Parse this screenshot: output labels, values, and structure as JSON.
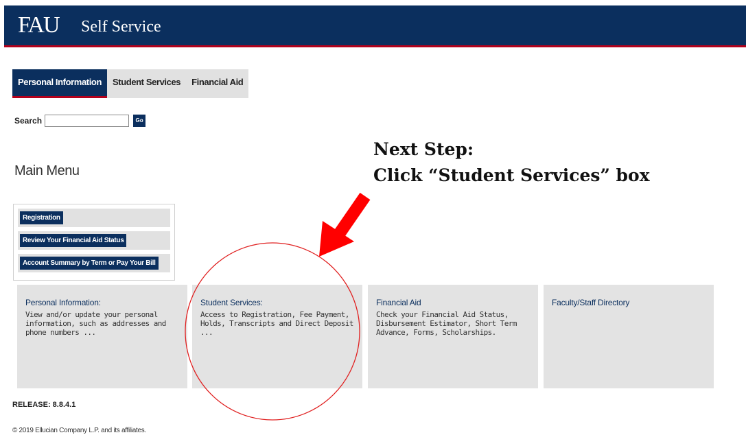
{
  "header": {
    "logo_text": "FAU",
    "app_title": "Self Service",
    "background": "#0b2f5e",
    "accent": "#b3001b"
  },
  "tabs": [
    {
      "label": "Personal Information",
      "active": true
    },
    {
      "label": "Student Services",
      "active": false
    },
    {
      "label": "Financial Aid",
      "active": false
    }
  ],
  "search": {
    "label": "Search",
    "value": "",
    "placeholder": "",
    "button_label": "Go"
  },
  "main_menu": {
    "title": "Main Menu",
    "quick_links": [
      {
        "label": "Registration"
      },
      {
        "label": "Review Your Financial Aid Status"
      },
      {
        "label": "Account Summary by Term or Pay Your Bill"
      }
    ],
    "cards": [
      {
        "title": "Personal Information:",
        "description": "View and/or update your personal information, such as addresses and phone numbers ..."
      },
      {
        "title": "Student Services:",
        "description": "Access to Registration, Fee Payment, Holds, Transcripts and Direct Deposit ..."
      },
      {
        "title": "Financial Aid",
        "description": "Check your Financial Aid Status, Disbursement Estimator, Short Term Advance, Forms, Scholarships."
      },
      {
        "title": "Faculty/Staff Directory",
        "description": ""
      }
    ]
  },
  "footer": {
    "release": "RELEASE: 8.8.4.1",
    "copyright": "© 2019 Ellucian Company L.P. and its affiliates."
  },
  "annotation": {
    "line1": "Next Step:",
    "line2": "Click “Student Services” box",
    "arrow_color": "#ff0000",
    "circle_color": "#e02020"
  }
}
